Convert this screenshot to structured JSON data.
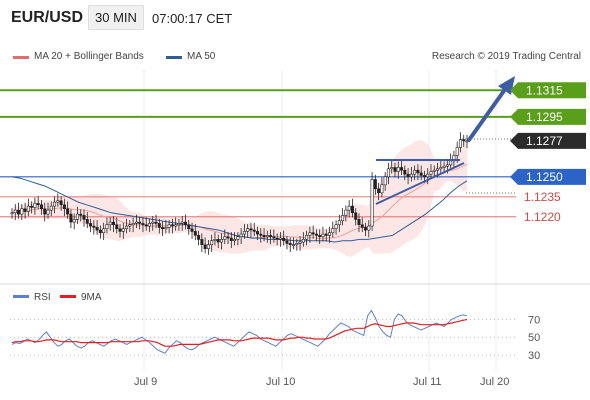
{
  "header": {
    "pair": "EUR/USD",
    "timeframe": "30 MIN",
    "time": "07:00:17 CET"
  },
  "legend": {
    "ma20": "MA 20 + Bollinger Bands",
    "ma50": "MA 50",
    "credit": "Research © 2019 Trading Central"
  },
  "colors": {
    "green": "#5a9f1a",
    "blue": "#2b63c6",
    "red": "#e36b6b",
    "ma50": "#2d5f96",
    "dark": "#2b2b2b",
    "candle": "#222222",
    "band": "#fbd2d2"
  },
  "levels": [
    {
      "value": "1.1315",
      "color": "green"
    },
    {
      "value": "1.1295",
      "color": "green"
    },
    {
      "value": "1.1277",
      "color": "dark"
    },
    {
      "value": "1.1250",
      "color": "blue"
    },
    {
      "value": "1.1235",
      "color": "red"
    },
    {
      "value": "1.1220",
      "color": "red"
    }
  ],
  "rsi_legend": {
    "rsi": "RSI",
    "ma9": "9MA"
  },
  "rsi_ticks": [
    "70",
    "50",
    "30"
  ],
  "x_ticks": [
    "Jul 9",
    "Jul 10",
    "Jul 11",
    "Jul 20"
  ],
  "chart_data": {
    "type": "candlestick",
    "yrange": [
      1.118,
      1.1325
    ],
    "levels": [
      1.1315,
      1.1295,
      1.1277,
      1.125,
      1.1235,
      1.122
    ],
    "close": [
      1.1223,
      1.1225,
      1.1222,
      1.1226,
      1.1224,
      1.1228,
      1.1227,
      1.123,
      1.1229,
      1.1226,
      1.1222,
      1.1225,
      1.1228,
      1.1231,
      1.1232,
      1.1229,
      1.1226,
      1.1222,
      1.1216,
      1.1218,
      1.1222,
      1.1221,
      1.1218,
      1.1215,
      1.1213,
      1.1212,
      1.121,
      1.1208,
      1.1211,
      1.1214,
      1.1216,
      1.1214,
      1.1211,
      1.1209,
      1.1211,
      1.1213,
      1.1214,
      1.1215,
      1.1216,
      1.1215,
      1.1214,
      1.1213,
      1.1215,
      1.1216,
      1.1215,
      1.1212,
      1.1211,
      1.1212,
      1.1214,
      1.1213,
      1.1214,
      1.1215,
      1.1216,
      1.1214,
      1.1211,
      1.1209,
      1.1206,
      1.1203,
      1.1199,
      1.1196,
      1.1199,
      1.1202,
      1.1203,
      1.1201,
      1.1203,
      1.1205,
      1.1204,
      1.1202,
      1.1203,
      1.1205,
      1.1207,
      1.1209,
      1.1211,
      1.121,
      1.1209,
      1.1207,
      1.1206,
      1.1205,
      1.1206,
      1.1205,
      1.1204,
      1.1203,
      1.1204,
      1.1202,
      1.12,
      1.1199,
      1.1199,
      1.12,
      1.1201,
      1.1203,
      1.1206,
      1.1208,
      1.1207,
      1.1206,
      1.1205,
      1.1207,
      1.1206,
      1.1208,
      1.1211,
      1.1214,
      1.1217,
      1.1221,
      1.1225,
      1.1228,
      1.1223,
      1.1218,
      1.1214,
      1.1212,
      1.121,
      1.1213,
      1.1248,
      1.1241,
      1.1238,
      1.1244,
      1.125,
      1.1256,
      1.1257,
      1.1254,
      1.1257,
      1.1255,
      1.1252,
      1.125,
      1.1252,
      1.1255,
      1.1253,
      1.1251,
      1.125,
      1.1252,
      1.1254,
      1.1255,
      1.1256,
      1.1257,
      1.1258,
      1.1259,
      1.1262,
      1.1266,
      1.1272,
      1.1278,
      1.1277,
      1.1277
    ],
    "ma50": [
      1.125,
      1.1249,
      1.1247,
      1.1245,
      1.1243,
      1.124,
      1.1237,
      1.1234,
      1.1231,
      1.1229,
      1.1227,
      1.1225,
      1.1223,
      1.1222,
      1.1221,
      1.122,
      1.1219,
      1.1218,
      1.1217,
      1.1216,
      1.1215,
      1.1214,
      1.1213,
      1.1212,
      1.1211,
      1.121,
      1.1208,
      1.1206,
      1.1205,
      1.1204,
      1.1204,
      1.1203,
      1.1203,
      1.1203,
      1.1202,
      1.1202,
      1.1202,
      1.1202,
      1.1202,
      1.1201,
      1.1202,
      1.1202,
      1.1203,
      1.1203,
      1.1204,
      1.1205,
      1.1206,
      1.121,
      1.1214,
      1.1218,
      1.1222,
      1.1227,
      1.1232,
      1.1238,
      1.1243,
      1.1247
    ],
    "rsi_range": [
      20,
      85
    ],
    "rsi_ticks": [
      70,
      50,
      30
    ],
    "rsi": [
      42,
      44,
      43,
      45,
      48,
      46,
      44,
      47,
      52,
      56,
      50,
      44,
      40,
      42,
      46,
      48,
      44,
      40,
      38,
      40,
      44,
      46,
      44,
      42,
      40,
      43,
      46,
      48,
      46,
      44,
      42,
      44,
      46,
      48,
      50,
      47,
      44,
      40,
      36,
      34,
      32,
      38,
      42,
      46,
      44,
      40,
      37,
      36,
      38,
      42,
      44,
      46,
      48,
      50,
      48,
      46,
      44,
      42,
      40,
      44,
      48,
      52,
      56,
      54,
      52,
      48,
      46,
      44,
      42,
      40,
      44,
      48,
      52,
      54,
      52,
      50,
      48,
      46,
      44,
      42,
      40,
      44,
      48,
      54,
      58,
      62,
      66,
      64,
      62,
      58,
      56,
      54,
      52,
      74,
      80,
      72,
      62,
      56,
      52,
      50,
      70,
      76,
      74,
      68,
      64,
      62,
      60,
      58,
      60,
      62,
      64,
      66,
      64,
      62,
      66,
      70,
      72,
      74,
      75,
      74
    ],
    "rsi_ma9": [
      44,
      45,
      45,
      46,
      46,
      46,
      45,
      45,
      46,
      47,
      47,
      47,
      46,
      45,
      45,
      45,
      45,
      45,
      44,
      44,
      44,
      44,
      44,
      44,
      44,
      44,
      45,
      45,
      45,
      45,
      45,
      45,
      45,
      45,
      46,
      46,
      46,
      45,
      44,
      42,
      40,
      40,
      40,
      41,
      42,
      42,
      42,
      42,
      42,
      42,
      43,
      44,
      45,
      46,
      47,
      47,
      47,
      47,
      46,
      46,
      46,
      47,
      48,
      49,
      49,
      49,
      49,
      49,
      48,
      47,
      47,
      47,
      48,
      49,
      49,
      50,
      50,
      49,
      49,
      48,
      48,
      48,
      48,
      49,
      51,
      53,
      55,
      57,
      58,
      59,
      60,
      60,
      60,
      62,
      64,
      65,
      64,
      63,
      62,
      62,
      63,
      64,
      65,
      66,
      66,
      66,
      65,
      64,
      64,
      64,
      64,
      64,
      64,
      64,
      65,
      66,
      67,
      68,
      69,
      70
    ]
  }
}
